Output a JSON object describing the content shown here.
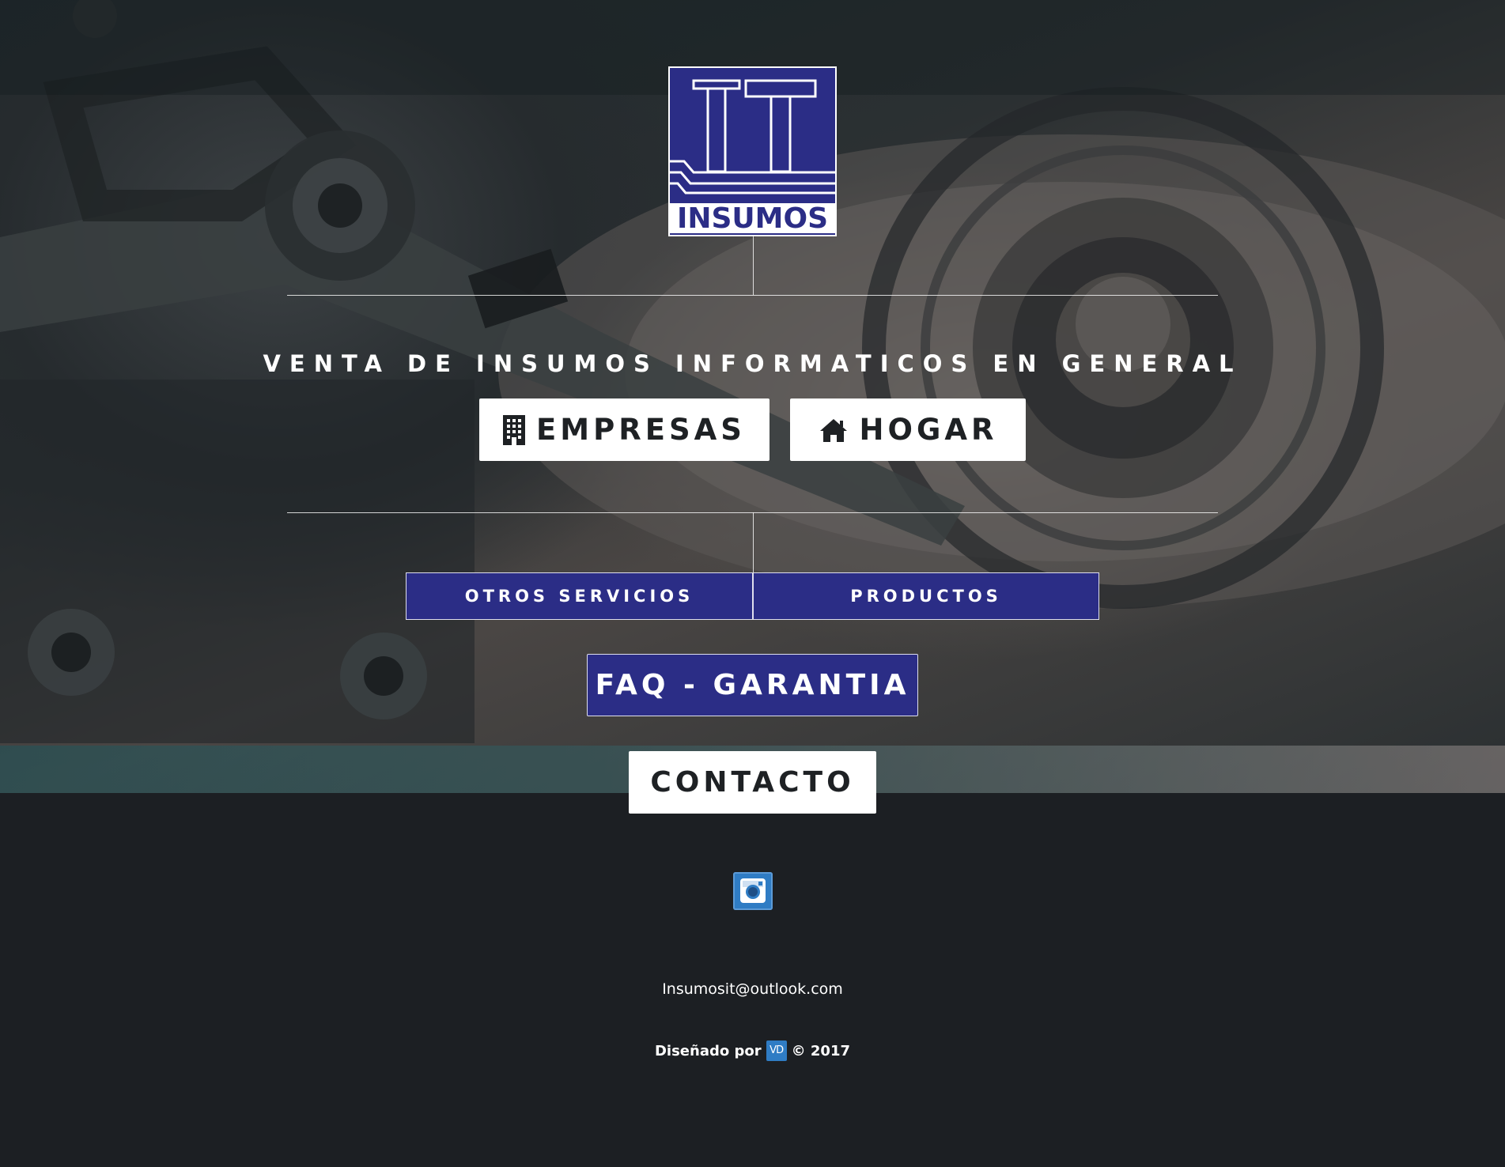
{
  "colors": {
    "brand_blue": "#2b2d86",
    "footer_bg": "#1c1f23",
    "button_white": "#ffffff",
    "instagram_blue": "#2f7cc4"
  },
  "logo": {
    "big_text": "IT",
    "word": "INSUMOS"
  },
  "hero": {
    "tagline": "VENTA DE INSUMOS INFORMATICOS EN GENERAL"
  },
  "buttons": {
    "empresas": {
      "label": "EMPRESAS",
      "icon": "building-icon"
    },
    "hogar": {
      "label": "HOGAR",
      "icon": "home-icon"
    },
    "otros_servicios": {
      "label": "OTROS SERVICIOS"
    },
    "productos": {
      "label": "PRODUCTOS"
    },
    "faq": {
      "label": "FAQ - GARANTIA"
    },
    "contacto": {
      "label": "CONTACTO"
    }
  },
  "footer": {
    "social_icon": "instagram-icon",
    "email": "Insumosit@outlook.com",
    "designed_by": "Diseñado por",
    "designer_logo": "VD",
    "copyright": "© 2017"
  }
}
